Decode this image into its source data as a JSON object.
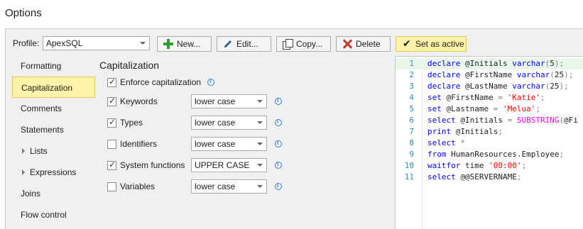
{
  "window": {
    "title": "Options"
  },
  "profile": {
    "label": "Profile:",
    "value": "ApexSQL"
  },
  "toolbar": {
    "new_label": "New...",
    "edit_label": "Edit...",
    "copy_label": "Copy...",
    "delete_label": "Delete",
    "set_active_label": "Set as active"
  },
  "nav": {
    "items": [
      {
        "label": "Formatting"
      },
      {
        "label": "Capitalization"
      },
      {
        "label": "Comments"
      },
      {
        "label": "Statements"
      },
      {
        "label": "Lists"
      },
      {
        "label": "Expressions"
      },
      {
        "label": "Joins"
      },
      {
        "label": "Flow control"
      }
    ]
  },
  "section": {
    "title": "Capitalization"
  },
  "options": {
    "enforce": {
      "label": "Enforce capitalization",
      "checked": true
    },
    "rows": [
      {
        "label": "Keywords",
        "checked": true,
        "value": "lower case"
      },
      {
        "label": "Types",
        "checked": true,
        "value": "lower case"
      },
      {
        "label": "Identifiers",
        "checked": false,
        "value": "lower case"
      },
      {
        "label": "System functions",
        "checked": true,
        "value": "UPPER CASE"
      },
      {
        "label": "Variables",
        "checked": false,
        "value": "lower case"
      }
    ]
  },
  "editor": {
    "lines": [
      {
        "n": "1",
        "tokens": [
          [
            "kw",
            "declare"
          ],
          [
            "pl",
            " @Initials "
          ],
          [
            "ty",
            "varchar"
          ],
          [
            "op",
            "("
          ],
          [
            "pl",
            "5"
          ],
          [
            "op",
            ");"
          ]
        ]
      },
      {
        "n": "2",
        "tokens": [
          [
            "kw",
            "declare"
          ],
          [
            "pl",
            " @FirstName "
          ],
          [
            "ty",
            "varchar"
          ],
          [
            "op",
            "("
          ],
          [
            "pl",
            "25"
          ],
          [
            "op",
            ");"
          ]
        ]
      },
      {
        "n": "3",
        "tokens": [
          [
            "kw",
            "declare"
          ],
          [
            "pl",
            " @LastName "
          ],
          [
            "ty",
            "varchar"
          ],
          [
            "op",
            "("
          ],
          [
            "pl",
            "25"
          ],
          [
            "op",
            ");"
          ]
        ]
      },
      {
        "n": "4",
        "tokens": [
          [
            "kw",
            "set"
          ],
          [
            "pl",
            " @FirstName "
          ],
          [
            "op",
            "="
          ],
          [
            "pl",
            " "
          ],
          [
            "st",
            "'Katie'"
          ],
          [
            "op",
            ";"
          ]
        ]
      },
      {
        "n": "5",
        "tokens": [
          [
            "kw",
            "set"
          ],
          [
            "pl",
            " @Lastname "
          ],
          [
            "op",
            "="
          ],
          [
            "pl",
            " "
          ],
          [
            "st",
            "'Melua'"
          ],
          [
            "op",
            ";"
          ]
        ]
      },
      {
        "n": "6",
        "tokens": [
          [
            "kw",
            "select"
          ],
          [
            "pl",
            " @Initials "
          ],
          [
            "op",
            "="
          ],
          [
            "pl",
            " "
          ],
          [
            "fn",
            "SUBSTRING"
          ],
          [
            "op",
            "("
          ],
          [
            "pl",
            "@Fi"
          ]
        ]
      },
      {
        "n": "7",
        "tokens": [
          [
            "kw",
            "print"
          ],
          [
            "pl",
            " @Initials"
          ],
          [
            "op",
            ";"
          ]
        ]
      },
      {
        "n": "8",
        "tokens": [
          [
            "kw",
            "select"
          ],
          [
            "pl",
            " "
          ],
          [
            "op",
            "*"
          ]
        ]
      },
      {
        "n": "9",
        "tokens": [
          [
            "kw",
            "from"
          ],
          [
            "pl",
            " HumanResources.Employee"
          ],
          [
            "op",
            ";"
          ]
        ]
      },
      {
        "n": "10",
        "tokens": [
          [
            "kw",
            "waitfor"
          ],
          [
            "pl",
            " time "
          ],
          [
            "st",
            "'00:00'"
          ],
          [
            "op",
            ";"
          ]
        ]
      },
      {
        "n": "11",
        "tokens": [
          [
            "kw",
            "select"
          ],
          [
            "pl",
            " @@SERVERNAME"
          ],
          [
            "op",
            ";"
          ]
        ]
      }
    ]
  }
}
